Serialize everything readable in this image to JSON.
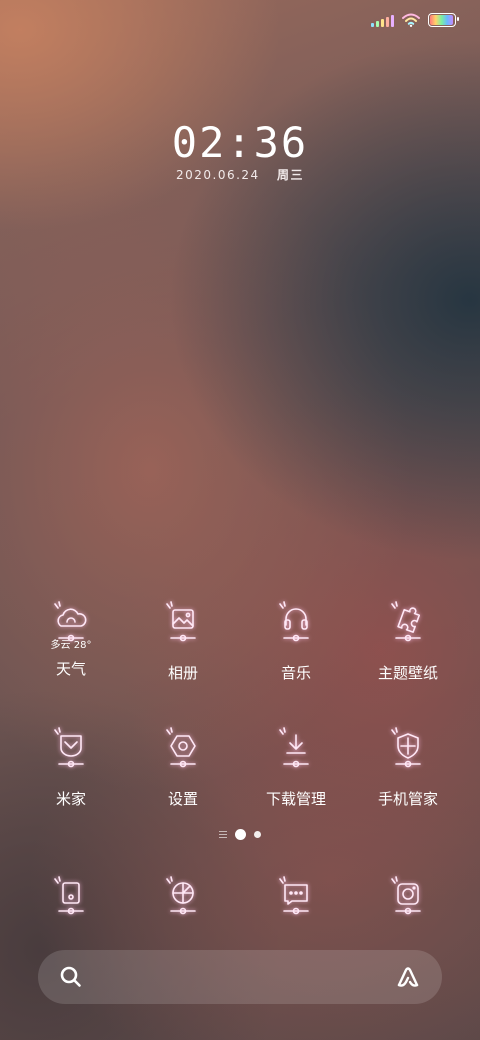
{
  "status_bar": {
    "signal_icon": "cellular-signal-icon",
    "wifi_icon": "wifi-icon",
    "battery_icon": "battery-icon",
    "battery_level": 0.95
  },
  "lockclock": {
    "time": "02:36",
    "date": "2020.06.24",
    "weekday": "周三"
  },
  "apps": [
    {
      "label": "天气",
      "sub": "多云 28°",
      "icon": "weather-cloud-icon"
    },
    {
      "label": "相册",
      "icon": "gallery-icon"
    },
    {
      "label": "音乐",
      "icon": "headphones-icon"
    },
    {
      "label": "主题壁纸",
      "icon": "puzzle-icon"
    },
    {
      "label": "米家",
      "icon": "mijia-icon"
    },
    {
      "label": "设置",
      "icon": "settings-gear-icon"
    },
    {
      "label": "下载管理",
      "icon": "download-icon"
    },
    {
      "label": "手机管家",
      "icon": "security-shield-icon"
    }
  ],
  "dock": [
    {
      "icon": "phone-icon"
    },
    {
      "icon": "browser-icon"
    },
    {
      "icon": "messages-icon"
    },
    {
      "icon": "camera-icon"
    }
  ],
  "pager": {
    "pages": 2,
    "current": 1
  },
  "search": {
    "icon": "search-icon",
    "assistant_icon": "assistant-icon"
  },
  "colors": {
    "icon_stroke": "#ffe8f6",
    "icon_glow": "#ffbee6"
  }
}
